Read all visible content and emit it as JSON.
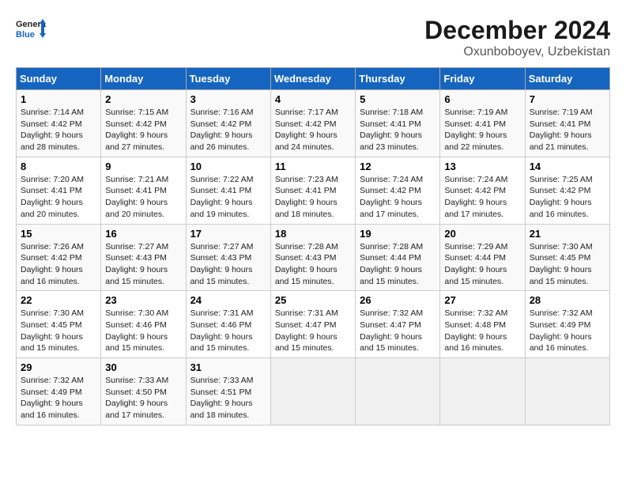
{
  "logo": {
    "line1": "General",
    "line2": "Blue"
  },
  "title": "December 2024",
  "location": "Oxunboboyev, Uzbekistan",
  "days_of_week": [
    "Sunday",
    "Monday",
    "Tuesday",
    "Wednesday",
    "Thursday",
    "Friday",
    "Saturday"
  ],
  "weeks": [
    [
      {
        "day": "1",
        "sunrise": "7:14 AM",
        "sunset": "4:42 PM",
        "daylight": "9 hours and 28 minutes."
      },
      {
        "day": "2",
        "sunrise": "7:15 AM",
        "sunset": "4:42 PM",
        "daylight": "9 hours and 27 minutes."
      },
      {
        "day": "3",
        "sunrise": "7:16 AM",
        "sunset": "4:42 PM",
        "daylight": "9 hours and 26 minutes."
      },
      {
        "day": "4",
        "sunrise": "7:17 AM",
        "sunset": "4:42 PM",
        "daylight": "9 hours and 24 minutes."
      },
      {
        "day": "5",
        "sunrise": "7:18 AM",
        "sunset": "4:41 PM",
        "daylight": "9 hours and 23 minutes."
      },
      {
        "day": "6",
        "sunrise": "7:19 AM",
        "sunset": "4:41 PM",
        "daylight": "9 hours and 22 minutes."
      },
      {
        "day": "7",
        "sunrise": "7:19 AM",
        "sunset": "4:41 PM",
        "daylight": "9 hours and 21 minutes."
      }
    ],
    [
      {
        "day": "8",
        "sunrise": "7:20 AM",
        "sunset": "4:41 PM",
        "daylight": "9 hours and 20 minutes."
      },
      {
        "day": "9",
        "sunrise": "7:21 AM",
        "sunset": "4:41 PM",
        "daylight": "9 hours and 20 minutes."
      },
      {
        "day": "10",
        "sunrise": "7:22 AM",
        "sunset": "4:41 PM",
        "daylight": "9 hours and 19 minutes."
      },
      {
        "day": "11",
        "sunrise": "7:23 AM",
        "sunset": "4:41 PM",
        "daylight": "9 hours and 18 minutes."
      },
      {
        "day": "12",
        "sunrise": "7:24 AM",
        "sunset": "4:42 PM",
        "daylight": "9 hours and 17 minutes."
      },
      {
        "day": "13",
        "sunrise": "7:24 AM",
        "sunset": "4:42 PM",
        "daylight": "9 hours and 17 minutes."
      },
      {
        "day": "14",
        "sunrise": "7:25 AM",
        "sunset": "4:42 PM",
        "daylight": "9 hours and 16 minutes."
      }
    ],
    [
      {
        "day": "15",
        "sunrise": "7:26 AM",
        "sunset": "4:42 PM",
        "daylight": "9 hours and 16 minutes."
      },
      {
        "day": "16",
        "sunrise": "7:27 AM",
        "sunset": "4:43 PM",
        "daylight": "9 hours and 15 minutes."
      },
      {
        "day": "17",
        "sunrise": "7:27 AM",
        "sunset": "4:43 PM",
        "daylight": "9 hours and 15 minutes."
      },
      {
        "day": "18",
        "sunrise": "7:28 AM",
        "sunset": "4:43 PM",
        "daylight": "9 hours and 15 minutes."
      },
      {
        "day": "19",
        "sunrise": "7:28 AM",
        "sunset": "4:44 PM",
        "daylight": "9 hours and 15 minutes."
      },
      {
        "day": "20",
        "sunrise": "7:29 AM",
        "sunset": "4:44 PM",
        "daylight": "9 hours and 15 minutes."
      },
      {
        "day": "21",
        "sunrise": "7:30 AM",
        "sunset": "4:45 PM",
        "daylight": "9 hours and 15 minutes."
      }
    ],
    [
      {
        "day": "22",
        "sunrise": "7:30 AM",
        "sunset": "4:45 PM",
        "daylight": "9 hours and 15 minutes."
      },
      {
        "day": "23",
        "sunrise": "7:30 AM",
        "sunset": "4:46 PM",
        "daylight": "9 hours and 15 minutes."
      },
      {
        "day": "24",
        "sunrise": "7:31 AM",
        "sunset": "4:46 PM",
        "daylight": "9 hours and 15 minutes."
      },
      {
        "day": "25",
        "sunrise": "7:31 AM",
        "sunset": "4:47 PM",
        "daylight": "9 hours and 15 minutes."
      },
      {
        "day": "26",
        "sunrise": "7:32 AM",
        "sunset": "4:47 PM",
        "daylight": "9 hours and 15 minutes."
      },
      {
        "day": "27",
        "sunrise": "7:32 AM",
        "sunset": "4:48 PM",
        "daylight": "9 hours and 16 minutes."
      },
      {
        "day": "28",
        "sunrise": "7:32 AM",
        "sunset": "4:49 PM",
        "daylight": "9 hours and 16 minutes."
      }
    ],
    [
      {
        "day": "29",
        "sunrise": "7:32 AM",
        "sunset": "4:49 PM",
        "daylight": "9 hours and 16 minutes."
      },
      {
        "day": "30",
        "sunrise": "7:33 AM",
        "sunset": "4:50 PM",
        "daylight": "9 hours and 17 minutes."
      },
      {
        "day": "31",
        "sunrise": "7:33 AM",
        "sunset": "4:51 PM",
        "daylight": "9 hours and 18 minutes."
      },
      null,
      null,
      null,
      null
    ]
  ]
}
